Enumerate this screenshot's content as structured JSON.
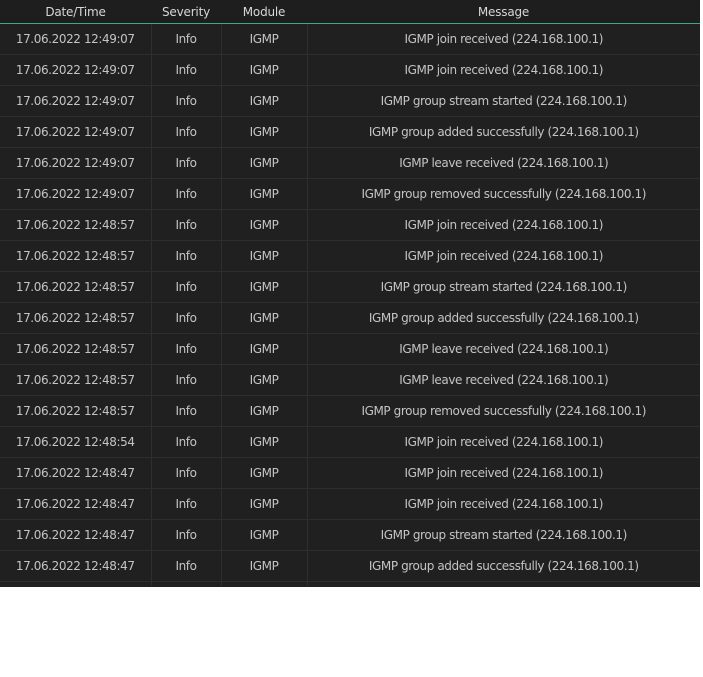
{
  "columns": {
    "datetime": "Date/Time",
    "severity": "Severity",
    "module": "Module",
    "message": "Message"
  },
  "rows": [
    {
      "datetime": "17.06.2022 12:49:07",
      "severity": "Info",
      "module": "IGMP",
      "message": "IGMP join received (224.168.100.1)"
    },
    {
      "datetime": "17.06.2022 12:49:07",
      "severity": "Info",
      "module": "IGMP",
      "message": "IGMP join received (224.168.100.1)"
    },
    {
      "datetime": "17.06.2022 12:49:07",
      "severity": "Info",
      "module": "IGMP",
      "message": "IGMP group stream started (224.168.100.1)"
    },
    {
      "datetime": "17.06.2022 12:49:07",
      "severity": "Info",
      "module": "IGMP",
      "message": "IGMP group added successfully (224.168.100.1)"
    },
    {
      "datetime": "17.06.2022 12:49:07",
      "severity": "Info",
      "module": "IGMP",
      "message": "IGMP leave received (224.168.100.1)"
    },
    {
      "datetime": "17.06.2022 12:49:07",
      "severity": "Info",
      "module": "IGMP",
      "message": "IGMP group removed successfully (224.168.100.1)"
    },
    {
      "datetime": "17.06.2022 12:48:57",
      "severity": "Info",
      "module": "IGMP",
      "message": "IGMP join received (224.168.100.1)"
    },
    {
      "datetime": "17.06.2022 12:48:57",
      "severity": "Info",
      "module": "IGMP",
      "message": "IGMP join received (224.168.100.1)"
    },
    {
      "datetime": "17.06.2022 12:48:57",
      "severity": "Info",
      "module": "IGMP",
      "message": "IGMP group stream started (224.168.100.1)"
    },
    {
      "datetime": "17.06.2022 12:48:57",
      "severity": "Info",
      "module": "IGMP",
      "message": "IGMP group added successfully (224.168.100.1)"
    },
    {
      "datetime": "17.06.2022 12:48:57",
      "severity": "Info",
      "module": "IGMP",
      "message": "IGMP leave received (224.168.100.1)"
    },
    {
      "datetime": "17.06.2022 12:48:57",
      "severity": "Info",
      "module": "IGMP",
      "message": "IGMP leave received (224.168.100.1)"
    },
    {
      "datetime": "17.06.2022 12:48:57",
      "severity": "Info",
      "module": "IGMP",
      "message": "IGMP group removed successfully (224.168.100.1)"
    },
    {
      "datetime": "17.06.2022 12:48:54",
      "severity": "Info",
      "module": "IGMP",
      "message": "IGMP join received (224.168.100.1)"
    },
    {
      "datetime": "17.06.2022 12:48:47",
      "severity": "Info",
      "module": "IGMP",
      "message": "IGMP join received (224.168.100.1)"
    },
    {
      "datetime": "17.06.2022 12:48:47",
      "severity": "Info",
      "module": "IGMP",
      "message": "IGMP join received (224.168.100.1)"
    },
    {
      "datetime": "17.06.2022 12:48:47",
      "severity": "Info",
      "module": "IGMP",
      "message": "IGMP group stream started (224.168.100.1)"
    },
    {
      "datetime": "17.06.2022 12:48:47",
      "severity": "Info",
      "module": "IGMP",
      "message": "IGMP group added successfully (224.168.100.1)"
    }
  ],
  "colors": {
    "background": "#202020",
    "header_underline": "#3fa88a",
    "text": "#c4c4c4"
  }
}
